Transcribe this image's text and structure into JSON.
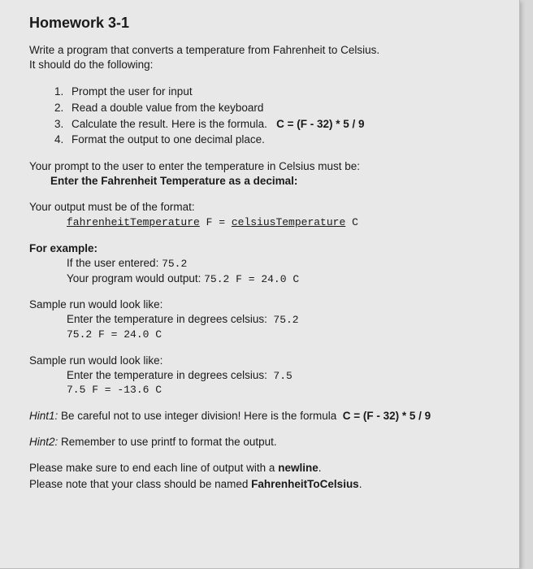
{
  "title": "Homework 3-1",
  "intro_line1": "Write a program that converts a temperature from Fahrenheit to Celsius.",
  "intro_line2": "It should do the following:",
  "steps": [
    "Prompt the user for input",
    "Read a double value from the keyboard",
    "Calculate the result. Here is the formula.",
    "Format the output to one decimal place."
  ],
  "formula_inline": "C = (F - 32) * 5 / 9",
  "prompt_text": "Your prompt to the user to enter the temperature in Celsius must be:",
  "prompt_value": "Enter the Fahrenheit Temperature as a decimal:",
  "output_text": "Your output must be of the format:",
  "output_var1": "fahrenheitTemperature",
  "output_mid": " F = ",
  "output_var2": "celsiusTemperature",
  "output_end": " C",
  "example_heading": "For example:",
  "example_if": "If the user entered: ",
  "example_if_val": "75.2",
  "example_out": "Your program would output: ",
  "example_out_val": "75.2 F = 24.0 C",
  "sample1_heading": "Sample run would look like:",
  "sample1_line1": "Enter the temperature in degrees celsius:",
  "sample1_val1": "75.2",
  "sample1_line2": "75.2 F = 24.0 C",
  "sample2_heading": "Sample run would look like:",
  "sample2_line1": "Enter the temperature in degrees celsius:",
  "sample2_val1": "7.5",
  "sample2_line2": "7.5 F = -13.6 C",
  "hint1_label": "Hint1:",
  "hint1_text": " Be careful not to use integer division! Here is the formula ",
  "hint1_formula": "C = (F - 32) * 5 / 9",
  "hint2_label": "Hint2:",
  "hint2_text": " Remember to use printf to format the output.",
  "note1_a": "Please make sure to end each line of output with a ",
  "note1_b": "newline",
  "note1_c": ".",
  "note2_a": "Please note that your class should be named ",
  "note2_b": "FahrenheitToCelsius",
  "note2_c": "."
}
